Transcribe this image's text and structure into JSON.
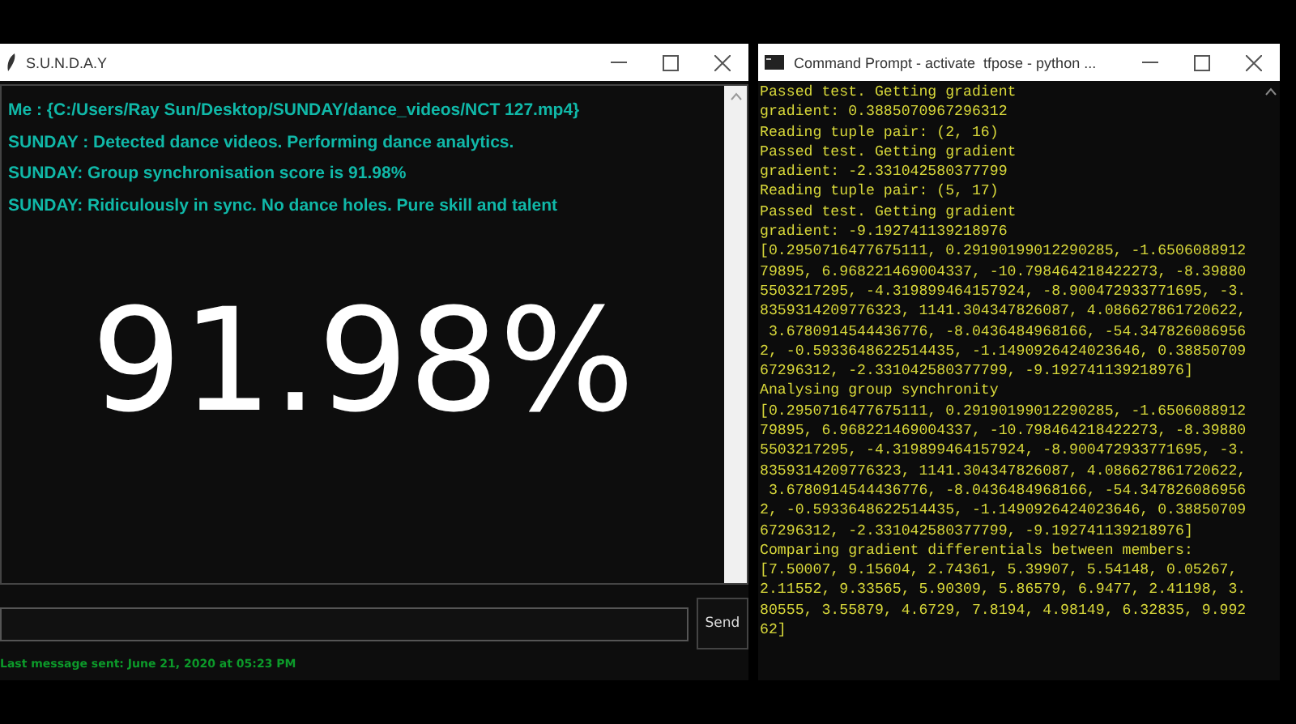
{
  "chat_window": {
    "title": "S.U.N.D.A.Y",
    "messages": [
      "Me : {C:/Users/Ray Sun/Desktop/SUNDAY/dance_videos/NCT 127.mp4}",
      "SUNDAY : Detected dance videos. Performing dance analytics.",
      "SUNDAY: Group synchronisation score is 91.98%",
      "SUNDAY: Ridiculously in sync. No dance holes. Pure skill and talent"
    ],
    "score": "91.98%",
    "send_button": "Send",
    "status": "Last message sent: June 21, 2020 at 05:23 PM"
  },
  "console_window": {
    "title": "Command Prompt - activate  tfpose - python ...",
    "lines": [
      "Passed test. Getting gradient",
      "gradient: 0.3885070967296312",
      "Reading tuple pair: (2, 16)",
      "Passed test. Getting gradient",
      "gradient: -2.331042580377799",
      "Reading tuple pair: (5, 17)",
      "Passed test. Getting gradient",
      "gradient: -9.192741139218976",
      "[0.2950716477675111, 0.29190199012290285, -1.6506088912",
      "79895, 6.968221469004337, -10.798464218422273, -8.39880",
      "5503217295, -4.319899464157924, -8.900472933771695, -3.",
      "8359314209776323, 1141.304347826087, 4.086627861720622,",
      " 3.6780914544436776, -8.0436484968166, -54.347826086956",
      "2, -0.5933648622514435, -1.1490926424023646, 0.38850709",
      "67296312, -2.331042580377799, -9.192741139218976]",
      "Analysing group synchronity",
      "[0.2950716477675111, 0.29190199012290285, -1.6506088912",
      "79895, 6.968221469004337, -10.798464218422273, -8.39880",
      "5503217295, -4.319899464157924, -8.900472933771695, -3.",
      "8359314209776323, 1141.304347826087, 4.086627861720622,",
      " 3.6780914544436776, -8.0436484968166, -54.347826086956",
      "2, -0.5933648622514435, -1.1490926424023646, 0.38850709",
      "67296312, -2.331042580377799, -9.192741139218976]",
      "Comparing gradient differentials between members:",
      "[7.50007, 9.15604, 2.74361, 5.39907, 5.54148, 0.05267,",
      "2.11552, 9.33565, 5.90309, 5.86579, 6.9477, 2.41198, 3.",
      "80555, 3.55879, 4.6729, 7.8194, 4.98149, 6.32835, 9.992",
      "62]"
    ]
  }
}
